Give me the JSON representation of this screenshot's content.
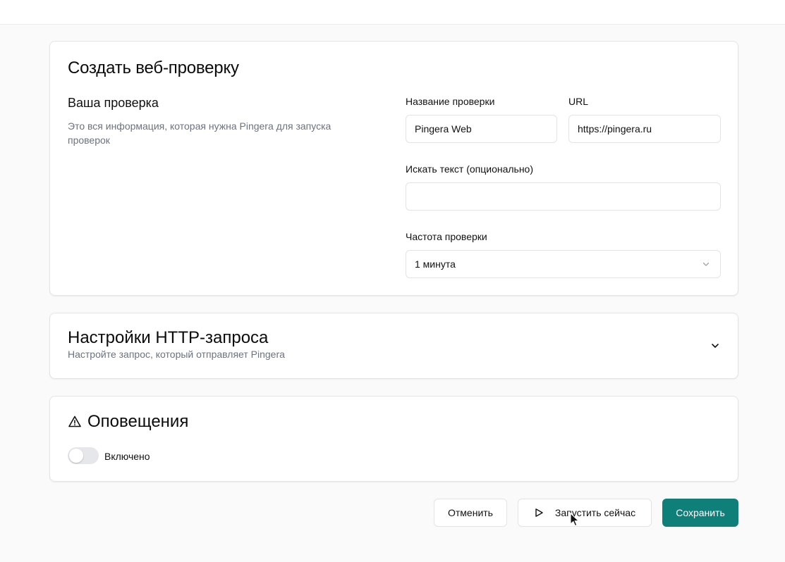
{
  "create_card": {
    "title": "Создать веб-проверку",
    "section_title": "Ваша проверка",
    "section_desc": "Это вся информация, которая нужна Pingera для запуска проверок",
    "fields": {
      "name_label": "Название проверки",
      "name_value": "Pingera Web",
      "url_label": "URL",
      "url_value": "https://pingera.ru",
      "search_label": "Искать текст (опционально)",
      "search_value": "",
      "frequency_label": "Частота проверки",
      "frequency_value": "1 минута"
    }
  },
  "http_card": {
    "title": "Настройки HTTP-запроса",
    "desc": "Настройте запрос, который отправляет Pingera"
  },
  "alerts_card": {
    "title": "Оповещения",
    "toggle_label": "Включено",
    "toggle_on": false
  },
  "actions": {
    "cancel": "Отменить",
    "run_now": "Запустить сейчас",
    "save": "Сохранить"
  },
  "colors": {
    "accent": "#0f7f7a",
    "muted_text": "#6b7280",
    "border": "#e4e4e7"
  },
  "icons": {
    "frequency_chevron": "chevron-down-icon",
    "http_expand": "chevron-down-icon",
    "alerts": "warning-triangle-icon",
    "run": "play-icon"
  }
}
